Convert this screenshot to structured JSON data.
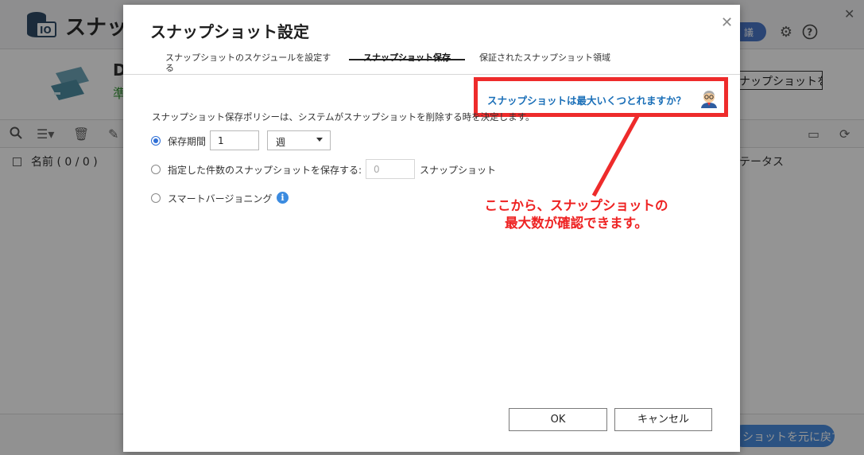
{
  "background": {
    "app_title": "スナップ",
    "device_name": "D",
    "device_status": "準",
    "top_pill": "議",
    "snapshot_button": "ナップショットを撮る",
    "name_column": "名前 ( 0 / 0 )",
    "status_column": "テータス",
    "revert_button": "ショットを元に戻す"
  },
  "dialog": {
    "title": "スナップショット設定",
    "tabs": [
      {
        "label": "スナップショットのスケジュールを設定する"
      },
      {
        "label": "スナップショット保存"
      },
      {
        "label": "保証されたスナップショット領域"
      }
    ],
    "help_link": "スナップショットは最大いくつとれますか？",
    "description": "スナップショット保存ポリシーは、システムがスナップショットを削除する時を決定します。",
    "options": {
      "retention": {
        "label": "保存期間",
        "value": "1",
        "unit": "週",
        "checked": true
      },
      "count": {
        "label": "指定した件数のスナップショットを保存する:",
        "value": "0",
        "suffix": "スナップショット",
        "checked": false
      },
      "smart": {
        "label": "スマートバージョニング",
        "checked": false
      }
    },
    "ok_label": "OK",
    "cancel_label": "キャンセル"
  },
  "annotation": {
    "line1": "ここから、スナップショットの",
    "line2": "最大数が確認できます。",
    "color": "#ee2b2b"
  },
  "colors": {
    "link": "#1a6fb8",
    "radio_checked": "#2f6fd6",
    "info_icon": "#3b8be0"
  }
}
